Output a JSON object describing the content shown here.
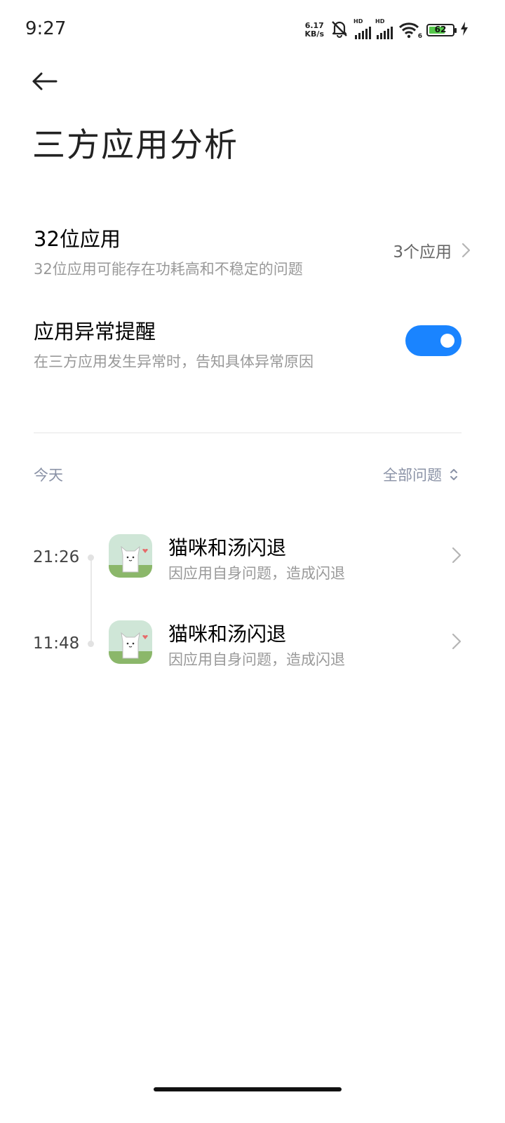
{
  "status_bar": {
    "time": "9:27",
    "net_speed_value": "6.17",
    "net_speed_unit": "KB/s",
    "sim1_label": "HD",
    "sim2_label": "HD",
    "wifi_label": "6",
    "battery_level": "62"
  },
  "header": {
    "title": "三方应用分析"
  },
  "settings": {
    "app32": {
      "title": "32位应用",
      "subtitle": "32位应用可能存在功耗高和不稳定的问题",
      "value": "3个应用"
    },
    "anomaly_alert": {
      "title": "应用异常提醒",
      "subtitle": "在三方应用发生异常时，告知具体异常原因",
      "enabled": true
    }
  },
  "section": {
    "day_label": "今天",
    "filter_label": "全部问题"
  },
  "events": [
    {
      "time": "21:26",
      "title": "猫咪和汤闪退",
      "description": "因应用自身问题，造成闪退",
      "icon": "cat-app-icon"
    },
    {
      "time": "11:48",
      "title": "猫咪和汤闪退",
      "description": "因应用自身问题，造成闪退",
      "icon": "cat-app-icon"
    }
  ],
  "colors": {
    "accent": "#1a84ff",
    "muted_text": "#999999",
    "section_text": "#8a92a6",
    "battery_fill": "#55c84b"
  }
}
